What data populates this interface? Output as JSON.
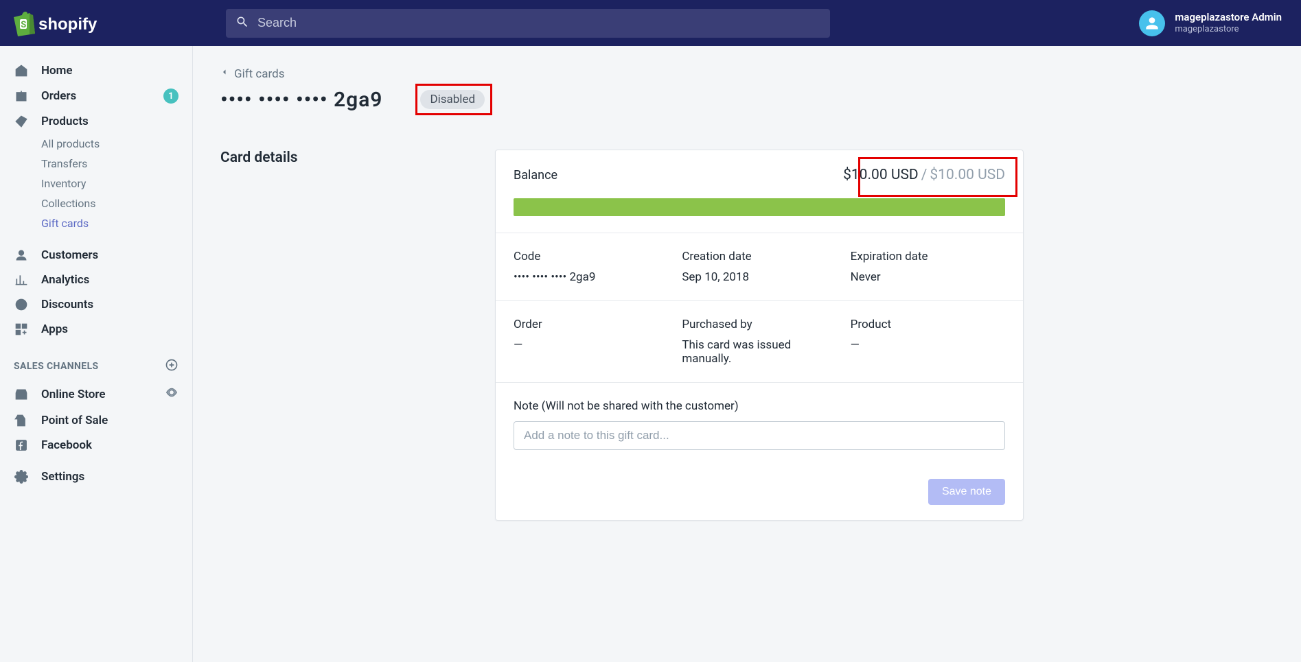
{
  "topbar": {
    "search_placeholder": "Search",
    "user_name": "mageplazastore Admin",
    "store_name": "mageplazastore"
  },
  "sidebar": {
    "home": "Home",
    "orders": "Orders",
    "orders_badge": "1",
    "products": "Products",
    "products_sub": {
      "all": "All products",
      "transfers": "Transfers",
      "inventory": "Inventory",
      "collections": "Collections",
      "gift_cards": "Gift cards"
    },
    "customers": "Customers",
    "analytics": "Analytics",
    "discounts": "Discounts",
    "apps": "Apps",
    "sales_channels_header": "SALES CHANNELS",
    "online_store": "Online Store",
    "pos": "Point of Sale",
    "facebook": "Facebook",
    "settings": "Settings"
  },
  "page": {
    "breadcrumb": "Gift cards",
    "title": "•••• •••• •••• 2ga9",
    "status": "Disabled",
    "section_label": "Card details"
  },
  "card": {
    "balance_label": "Balance",
    "balance_current": "$10.00 USD",
    "balance_original": "$10.00 USD",
    "code_label": "Code",
    "code_value": "•••• •••• •••• 2ga9",
    "creation_label": "Creation date",
    "creation_value": "Sep 10, 2018",
    "expiration_label": "Expiration date",
    "expiration_value": "Never",
    "order_label": "Order",
    "order_value": "—",
    "purchased_label": "Purchased by",
    "purchased_value": "This card was issued manually.",
    "product_label": "Product",
    "product_value": "—",
    "note_label": "Note (Will not be shared with the customer)",
    "note_placeholder": "Add a note to this gift card...",
    "save_button": "Save note"
  }
}
